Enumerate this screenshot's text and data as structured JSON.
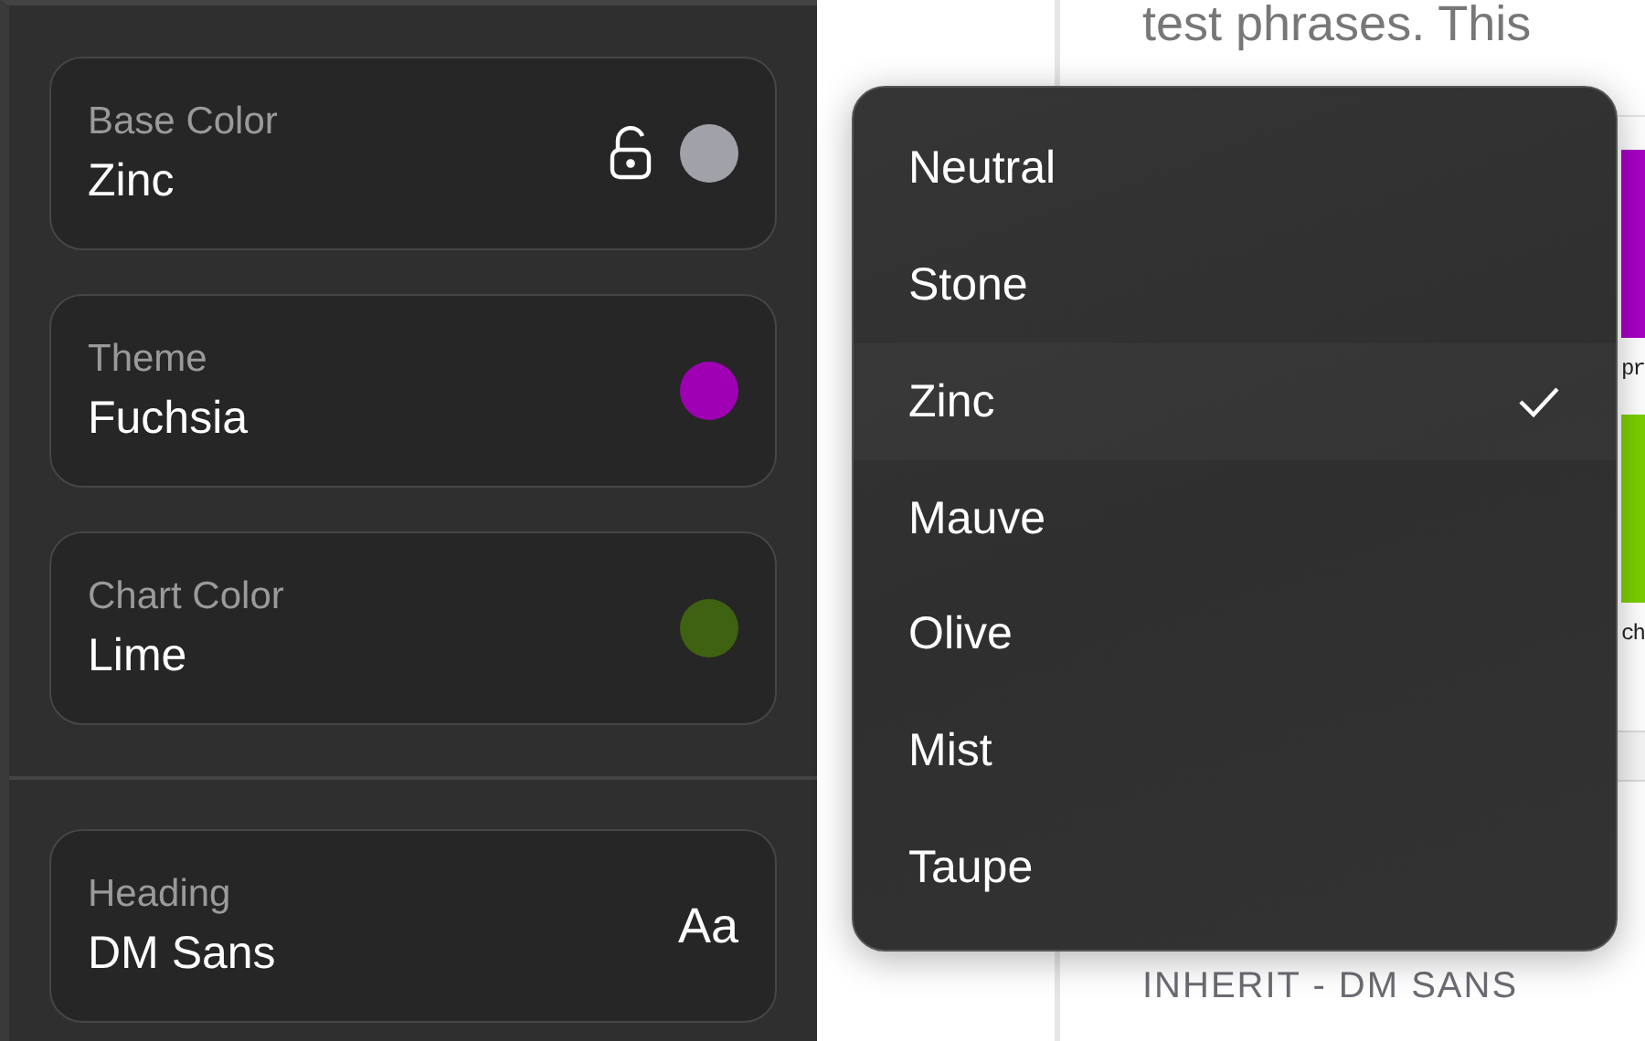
{
  "sidebar": {
    "color_fields": [
      {
        "label": "Base Color",
        "value": "Zinc",
        "color": "#a1a1aa",
        "locked": false
      },
      {
        "label": "Theme",
        "value": "Fuchsia",
        "color": "#a000b4"
      },
      {
        "label": "Chart Color",
        "value": "Lime",
        "color": "#3f6212"
      }
    ],
    "font_fields": [
      {
        "label": "Heading",
        "value": "DM Sans",
        "sample": "Aa"
      }
    ]
  },
  "preview": {
    "heading": "test phrases. This",
    "swatches": [
      {
        "color": "#a800c4",
        "caption": "pr"
      },
      {
        "color": "#7ccf00",
        "caption": "ch"
      }
    ],
    "font_caption": "INHERIT - DM SANS"
  },
  "dropdown": {
    "options": [
      {
        "label": "Neutral",
        "selected": false
      },
      {
        "label": "Stone",
        "selected": false
      },
      {
        "label": "Zinc",
        "selected": true
      },
      {
        "label": "Mauve",
        "selected": false
      },
      {
        "label": "Olive",
        "selected": false
      },
      {
        "label": "Mist",
        "selected": false
      },
      {
        "label": "Taupe",
        "selected": false
      }
    ]
  }
}
